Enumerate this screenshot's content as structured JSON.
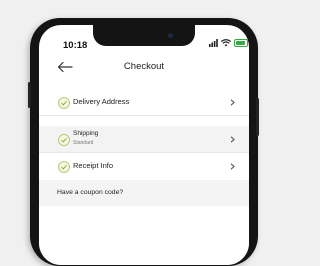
{
  "status_bar": {
    "time": "10:18"
  },
  "header": {
    "title": "Checkout",
    "back_icon": "arrow-left-icon"
  },
  "steps": [
    {
      "label": "Delivery Address",
      "sublabel": "",
      "icon": "check-circle-icon"
    },
    {
      "label": "Shipping",
      "sublabel": "Standard",
      "icon": "check-circle-icon"
    },
    {
      "label": "Receipt Info",
      "sublabel": "",
      "icon": "check-circle-icon"
    }
  ],
  "coupon": {
    "label": "Have a coupon code?"
  },
  "colors": {
    "check_green": "#8fae3a",
    "battery_green": "#39a845",
    "row_shade": "#f3f3f3"
  }
}
